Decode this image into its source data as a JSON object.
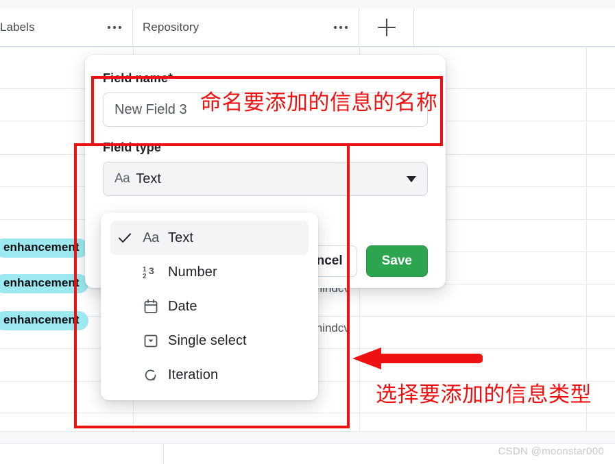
{
  "header": {
    "columns": [
      {
        "title": "Labels",
        "menu_icon": "kebab-menu-icon"
      },
      {
        "title": "Repository",
        "menu_icon": "kebab-menu-icon"
      }
    ],
    "add_column_icon": "plus-icon"
  },
  "background_table": {
    "label_badge_text": "enhancement",
    "label_badge_color": "#9ceaef",
    "repo_cells": [
      "mindcv",
      "mindcv"
    ]
  },
  "dialog": {
    "field_name": {
      "label": "Field name",
      "required_marker": "*",
      "value": "New Field 3"
    },
    "field_type": {
      "label": "Field type",
      "selected_icon": "Aa",
      "selected_value": "Text",
      "caret_icon": "chevron-down-icon"
    },
    "buttons": {
      "cancel": "Cancel",
      "save": "Save",
      "save_color": "#2da44e"
    }
  },
  "type_menu": {
    "items": [
      {
        "label": "Text",
        "icon": "Aa",
        "icon_name": "text-type-icon",
        "checked": true
      },
      {
        "label": "Number",
        "icon": "¹₂³",
        "icon_name": "number-type-icon",
        "checked": false
      },
      {
        "label": "Date",
        "icon": "calendar",
        "icon_name": "calendar-icon",
        "checked": false
      },
      {
        "label": "Single select",
        "icon": "select",
        "icon_name": "single-select-icon",
        "checked": false
      },
      {
        "label": "Iteration",
        "icon": "iteration",
        "icon_name": "iteration-icon",
        "checked": false
      }
    ],
    "check_icon": "check-icon"
  },
  "annotations": {
    "color": "#ee1111",
    "note_top": "命名要添加的信息的名称",
    "note_bottom": "选择要添加的信息类型",
    "arrow_icon": "left-arrow-icon"
  },
  "watermark": "CSDN @moonstar000"
}
